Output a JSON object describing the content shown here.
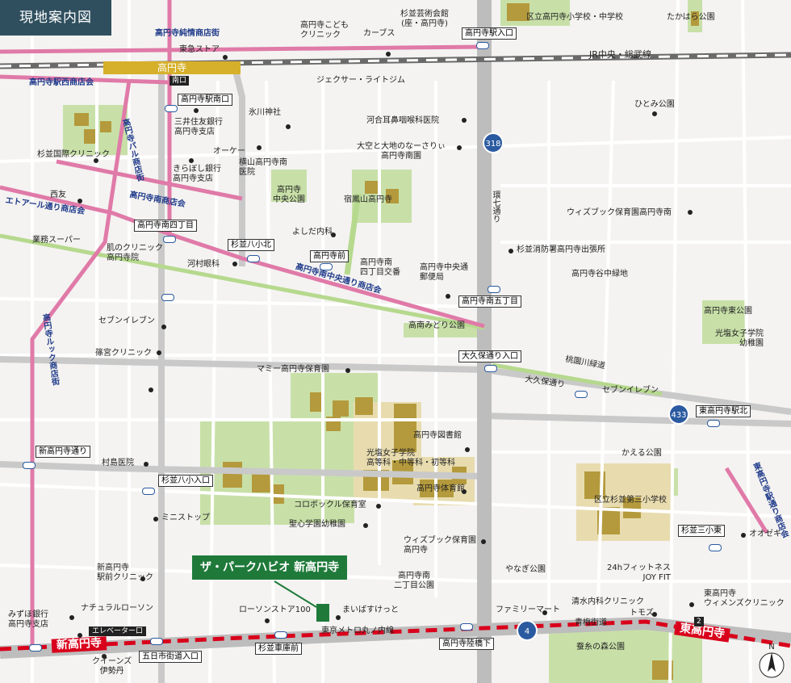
{
  "title": "現地案内図",
  "station": {
    "name": "高円寺",
    "exit": "南口"
  },
  "railway": "JR中央・総武線",
  "metro_line": "東京メトロ丸ノ内線",
  "metro_stations": [
    "新高円寺",
    "東高円寺"
  ],
  "elevator_exit": "エレベーター口",
  "exit_2": "2",
  "target_property": "ザ・パークハビオ 新高円寺",
  "route_shields": [
    "318",
    "433",
    "4"
  ],
  "colors": {
    "title_bg": "#2f4f5f",
    "station": "#d6b02a",
    "shopping_street": "#e07aa8",
    "metro": "#d9001b",
    "target": "#1f7a3a",
    "park": "#c8e0a8",
    "school": "#e8dcaf",
    "shield": "#2a5aa0"
  },
  "shopping_streets": {
    "junjo": "高円寺純情商店街",
    "ekinishi": "高円寺駅西商店会",
    "pal": "高円寺パル商店街",
    "minami": "高円寺南商店会",
    "eterle": "エトアール通り商店会",
    "chuo": "高円寺南中央通り商店会",
    "look": "高円寺ルック商店街",
    "higashi": "東高円寺駅通り商店会"
  },
  "roads": {
    "kannana": "環七通り",
    "okubo": "大久保通り",
    "ome": "青梅街道",
    "toen": "桃園川緑道"
  },
  "bus_stops": [
    "高円寺駅入口",
    "高円寺駅南口",
    "高円寺南四丁目",
    "杉並八小北",
    "高円寺前",
    "高円寺南五丁目",
    "大久保通り入口",
    "東高円寺駅北",
    "新高円寺通り",
    "杉並八小入口",
    "杉並三小東",
    "五日市街道入口",
    "杉並車庫前",
    "高円寺陸橋下"
  ],
  "labels": {
    "tokyu": "東急ストア",
    "kodomo": "高円寺こども\nクリニック",
    "carves": "カーブス",
    "geijutsu": "杉並芸術会館\n(座・高円寺)",
    "school1": "区立高円寺小学校・中学校",
    "takahara": "たかはら公園",
    "jexer": "ジェクサー・ライトジム",
    "hikawa": "氷川神社",
    "kawai": "河合耳鼻咽喉科医院",
    "hitomi": "ひとみ公園",
    "mitsui": "三井住友銀行\n高円寺支店",
    "okay": "オーケー",
    "yokoyama": "横山高円寺南\n医院",
    "kiraboshi": "きらぼし銀行\n高円寺支店",
    "ozora": "大空と大地のなーさりぃ\n高円寺南園",
    "kokusai": "杉並国際クリニック",
    "chuokoen": "高円寺\n中央公園",
    "shukuhou": "宿鳳山高円寺",
    "seiyu": "西友",
    "gyomu": "業務スーパー",
    "hada": "肌のクリニック\n高円寺院",
    "yoshida": "よしだ内科",
    "wiz1": "ウィズブック保育園高円寺南",
    "kawamura": "河村眼科",
    "koban": "高円寺南\n四丁目交番",
    "yubin": "高円寺中央通\n郵便局",
    "shobo": "杉並消防署高円寺出張所",
    "yachunaka": "高円寺谷中緑地",
    "seven1": "セブンイレブン",
    "konanmidori": "高南みどり公園",
    "higashikoen": "高円寺東公園",
    "kosei_yochien": "光塩女子学院\n幼稚園",
    "shinomiya": "篠宮クリニック",
    "mommy": "マミー高円寺保育園",
    "seven2": "セブンイレブン",
    "toshokan": "高円寺図書館",
    "kosei": "光塩女子学院\n高等科・中等科・初等科",
    "kaeru": "かえる公園",
    "murashima": "村島医院",
    "taiikukan": "高円寺体育館",
    "school3": "区立杉並第三小学校",
    "korobokkuru": "コロボックル保育室",
    "seishin": "聖心学園幼稚園",
    "ministop": "ミニストップ",
    "ozeki": "オオゼキ",
    "wiz2": "ウィズブック保育園\n高円寺",
    "yanagi": "やなぎ公園",
    "joyfit": "24hフィットネス\nJOY FIT",
    "ekimae": "新高円寺\n駅前クリニック",
    "nichome": "高円寺南\n二丁目公園",
    "natural": "ナチュラルローソン",
    "lawson": "ローソンストア100",
    "maibasket": "まいばすけっと",
    "mizuho": "みずほ銀行\n高円寺支店",
    "family": "ファミリーマート",
    "kiyomizu": "清水内科クリニック",
    "tomods": "トモズ",
    "womens": "東高円寺\nウィメンズクリニック",
    "queens": "クイーンズ\n伊勢丹",
    "sanshi": "蚕糸の森公園"
  },
  "compass": "N"
}
